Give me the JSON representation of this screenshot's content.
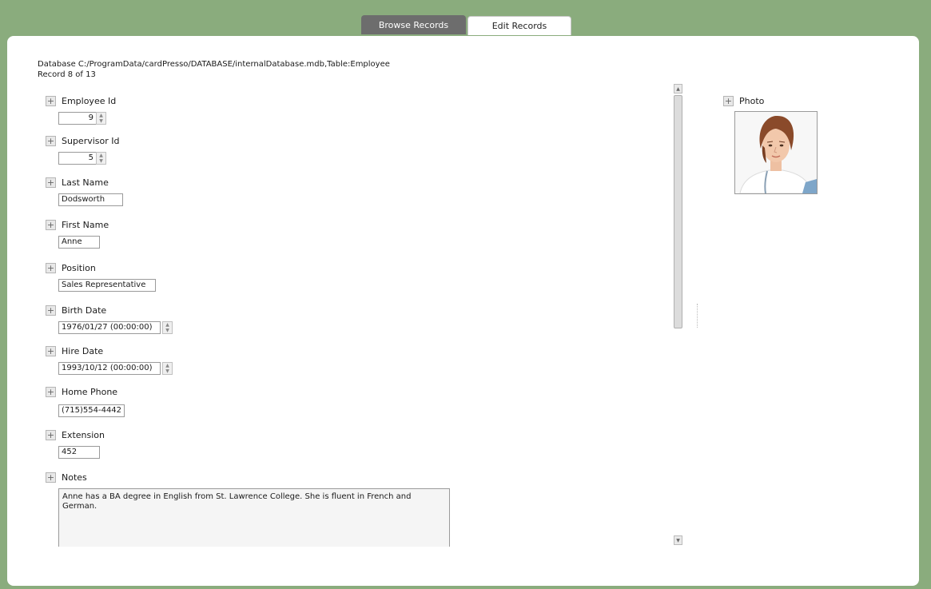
{
  "tabs": [
    {
      "label": "Browse Records",
      "active": false
    },
    {
      "label": "Edit Records",
      "active": true
    }
  ],
  "header": {
    "database_path": "Database C:/ProgramData/cardPresso/DATABASE/internalDatabase.mdb,Table:Employee",
    "record_position": "Record 8 of 13"
  },
  "fields": {
    "employee_id": {
      "label": "Employee Id",
      "value": "9"
    },
    "supervisor_id": {
      "label": "Supervisor Id",
      "value": "5"
    },
    "last_name": {
      "label": "Last Name",
      "value": "Dodsworth"
    },
    "first_name": {
      "label": "First Name",
      "value": "Anne"
    },
    "position": {
      "label": "Position",
      "value": "Sales Representative"
    },
    "birth_date": {
      "label": "Birth Date",
      "value": "1976/01/27 (00:00:00)"
    },
    "hire_date": {
      "label": "Hire Date",
      "value": "1993/10/12 (00:00:00)"
    },
    "home_phone": {
      "label": "Home Phone",
      "value": "(715)554-4442"
    },
    "extension": {
      "label": "Extension",
      "value": "452"
    },
    "notes": {
      "label": "Notes",
      "value": "Anne has a BA degree in English from St. Lawrence College.  She is fluent in French and German."
    }
  },
  "photo": {
    "label": "Photo"
  },
  "expand_symbol": "+",
  "icons": {
    "expand": "plus-icon",
    "spin": "spin-arrows-icon",
    "scroll_up": "arrow-up-icon",
    "scroll_down": "arrow-down-icon"
  },
  "colors": {
    "background": "#8aac7d",
    "active_tab": "#6d6d6d",
    "panel": "#ffffff"
  }
}
